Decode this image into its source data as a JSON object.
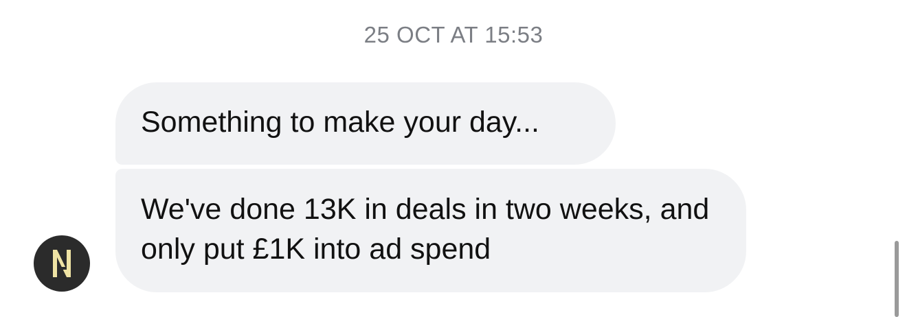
{
  "conversation": {
    "timestamp": "25 OCT AT 15:53",
    "messages": [
      {
        "text": "Something to make your day..."
      },
      {
        "text": "We've done 13K in deals in two weeks, and only put £1K into ad spend"
      }
    ],
    "sender": {
      "avatar_icon": "n-monogram-avatar-icon",
      "avatar_color": "#2b2b2b",
      "monogram_color": "#efe3a4"
    }
  },
  "colors": {
    "bubble_background": "#f1f2f4",
    "timestamp_text": "#7b7e84",
    "message_text": "#111111"
  }
}
